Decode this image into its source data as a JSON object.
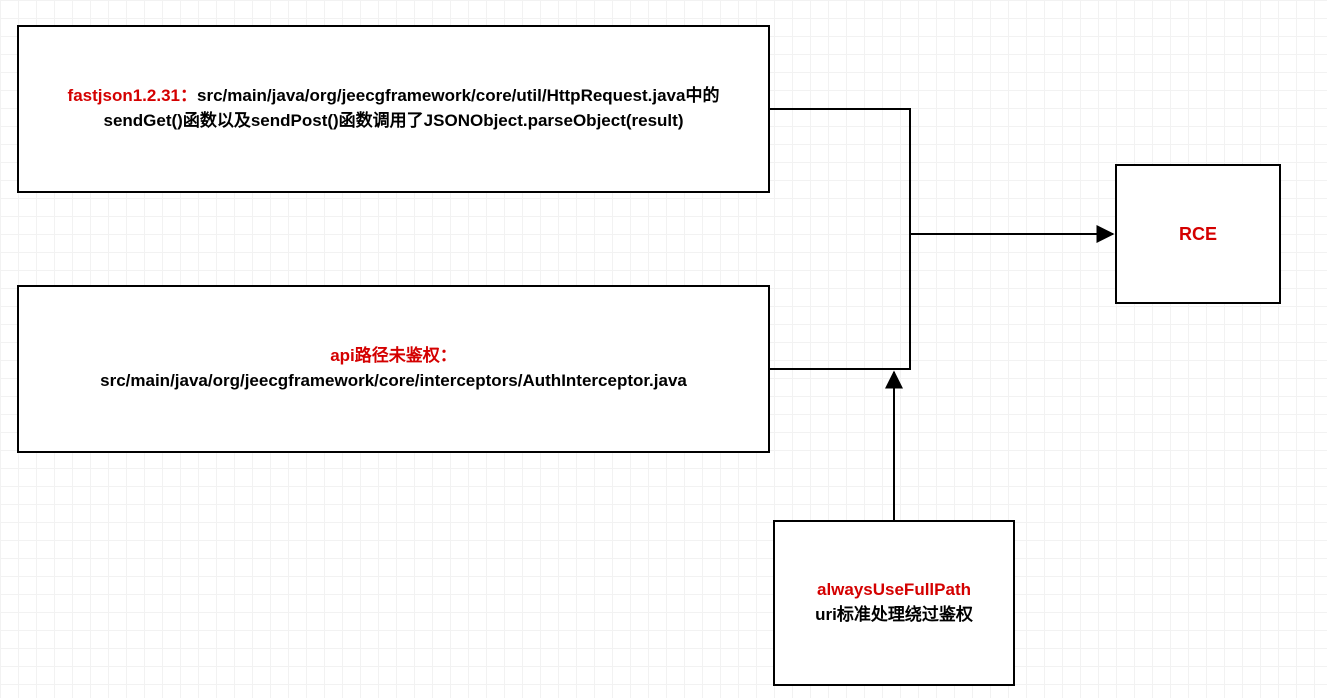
{
  "nodes": {
    "fastjson": {
      "line1_hl": "fastjson1.2.31：",
      "line1_rest": "src/main/java/org/jeecgframework/core/util/HttpRequest.java中的",
      "line2": "sendGet()函数以及sendPost()函数调用了JSONObject.parseObject(result)"
    },
    "api": {
      "line1_hl": "api路径未鉴权：",
      "line2": "src/main/java/org/jeecgframework/core/interceptors/AuthInterceptor.java"
    },
    "always": {
      "line1_hl": "alwaysUseFullPath",
      "line2": "uri标准处理绕过鉴权"
    },
    "rce": {
      "label": "RCE"
    }
  }
}
